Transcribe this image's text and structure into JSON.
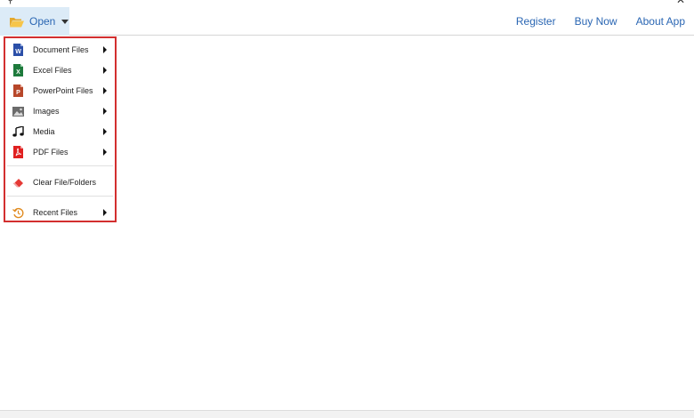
{
  "toolbar": {
    "open_label": "Open",
    "links": [
      {
        "label": "Register"
      },
      {
        "label": "Buy Now"
      },
      {
        "label": "About App"
      }
    ]
  },
  "menu": {
    "items": [
      {
        "label": "Document Files",
        "icon": "word-document-icon",
        "submenu": true
      },
      {
        "label": "Excel Files",
        "icon": "excel-icon",
        "submenu": true
      },
      {
        "label": "PowerPoint Files",
        "icon": "powerpoint-icon",
        "submenu": true
      },
      {
        "label": "Images",
        "icon": "image-icon",
        "submenu": true
      },
      {
        "label": "Media",
        "icon": "music-note-icon",
        "submenu": true
      },
      {
        "label": "PDF Files",
        "icon": "pdf-icon",
        "submenu": true
      },
      {
        "label": "Clear File/Folders",
        "icon": "eraser-icon",
        "submenu": false
      },
      {
        "label": "Recent Files",
        "icon": "history-icon",
        "submenu": true
      }
    ]
  },
  "colors": {
    "accent_blue": "#2a66b3",
    "open_button_bg": "#dcebf7",
    "menu_border": "#d32f2f",
    "word": "#2b4fa8",
    "excel": "#1e7a3c",
    "powerpoint": "#b7472a",
    "pdf": "#e02020",
    "eraser": "#e53935",
    "history": "#e08a1e"
  }
}
